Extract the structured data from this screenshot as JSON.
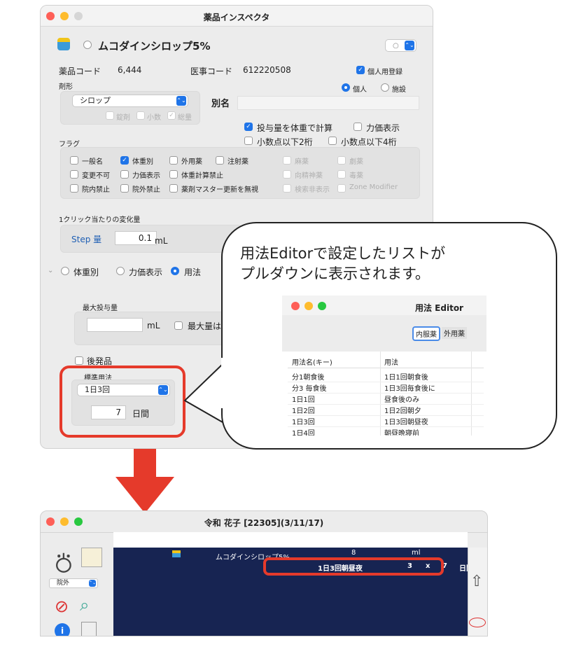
{
  "inspector": {
    "title": "薬品インスペクタ",
    "drug_name": "ムコダインシロップ5%",
    "code_label": "薬品コード",
    "code_value": "6,444",
    "iji_label": "医事コード",
    "iji_value": "612220508",
    "personal_reg": "個人用登録",
    "radio_personal": "個人",
    "radio_facility": "施設",
    "form_label": "剤形",
    "form_value": "シロップ",
    "alias_label": "別名",
    "form_opts": [
      "錠剤",
      "小数",
      "総量"
    ],
    "weight_calc": "投与量を体重で計算",
    "potency_show": "力価表示",
    "dec2": "小数点以下2桁",
    "dec4": "小数点以下4桁",
    "flag_label": "フラグ",
    "flags": [
      [
        "一般名",
        "体重別",
        "外用薬",
        "注射薬",
        "麻薬",
        "劇薬"
      ],
      [
        "変更不可",
        "力価表示",
        "体重計算禁止",
        "",
        "向精神薬",
        "毒薬"
      ],
      [
        "院内禁止",
        "院外禁止",
        "薬剤マスター更新を無視",
        "",
        "検索非表示",
        "Zone Modifier"
      ]
    ],
    "click_label": "1クリック当たりの変化量",
    "step_label": "Step 量",
    "step_value": "0.1",
    "step_unit": "mL",
    "mode_weight": "体重別",
    "mode_potency": "力価表示",
    "mode_usage": "用法",
    "max_label": "最大投与量",
    "max_unit": "mL",
    "max_chk": "最大量は",
    "generic": "後発品",
    "std_label": "標準用法",
    "std_value": "1日3回",
    "days_value": "7",
    "days_unit": "日間"
  },
  "callout": {
    "line1": "用法Editorで設定したリストが",
    "line2": "プルダウンに表示されます。",
    "mini_title": "用法 Editor",
    "tab_internal": "内服薬",
    "tab_external": "外用薬",
    "col_key": "用法名(キー)",
    "col_usage": "用法",
    "rows": [
      [
        "分1朝食後",
        "1日1回朝食後"
      ],
      [
        "分3 毎食後",
        "1日3回毎食後に"
      ],
      [
        "1日1回",
        "昼食後のみ"
      ],
      [
        "1日2回",
        "1日2回朝夕"
      ],
      [
        "1日3回",
        "1日3回朝昼夜"
      ],
      [
        "1日4回",
        "朝昼晩寝前"
      ]
    ]
  },
  "karte": {
    "title": "令和 花子 [22305](3/11/17)",
    "dept": "院外",
    "drug": "ムコダインシロップ5%",
    "qty": "8",
    "unit": "ml",
    "usage": "1日3回朝昼夜",
    "mult": "3",
    "x": "x",
    "days": "7",
    "days_unit": "日間"
  },
  "colors": {
    "accent": "#1f74e8",
    "highlight": "#e53a2b",
    "navy": "#172452"
  }
}
